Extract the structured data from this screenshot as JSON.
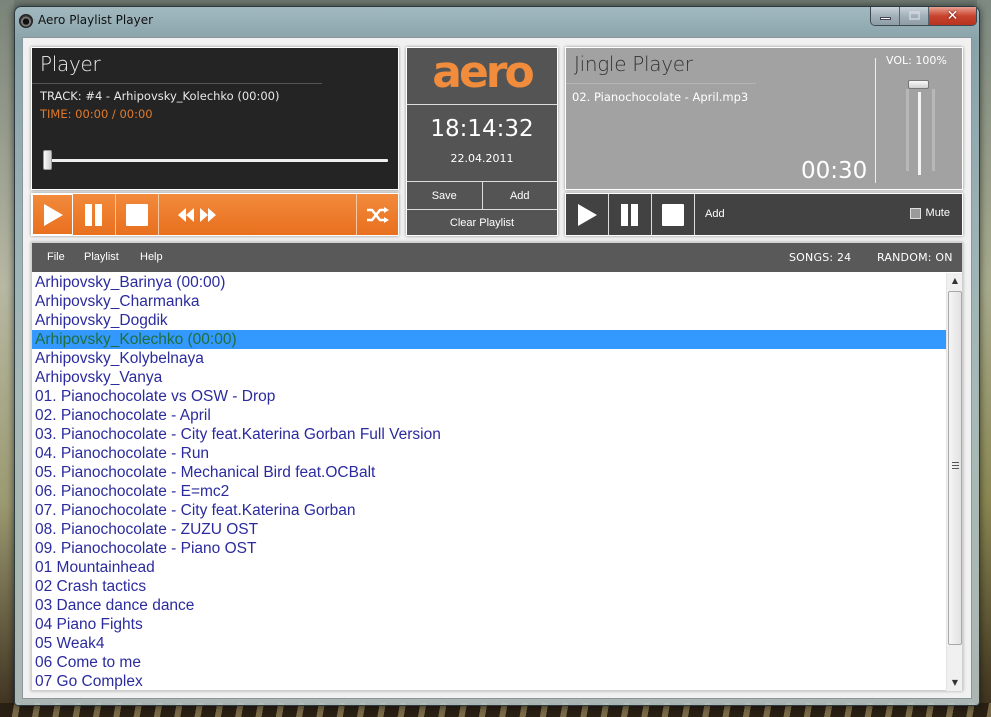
{
  "window": {
    "title": "Aero Playlist Player",
    "controls": {
      "minimize": "minimize",
      "maximize": "maximize",
      "close": "close"
    }
  },
  "player": {
    "title": "Player",
    "track": "TRACK: #4 - Arhipovsky_Kolechko (00:00)",
    "time": "TIME: 00:00 / 00:00",
    "seek_position_fraction": 0.0,
    "controls": [
      "play",
      "pause",
      "stop",
      "previous",
      "next",
      "shuffle"
    ]
  },
  "center": {
    "logo": "aero",
    "clock": "18:14:32",
    "date": "22.04.2011",
    "save_label": "Save",
    "add_label": "Add",
    "clear_label": "Clear Playlist"
  },
  "jingle": {
    "title": "Jingle Player",
    "file": "02. Pianochocolate - April.mp3",
    "remaining": "00:30",
    "volume_label": "VOL: 100%",
    "volume_fraction": 1.0,
    "add_label": "Add",
    "mute_label": "Mute",
    "mute_checked": false
  },
  "playlist": {
    "menu": [
      "File",
      "Playlist",
      "Help"
    ],
    "songs_count": "SONGS: 24",
    "random": "RANDOM: ON",
    "selected_index": 3,
    "songs": [
      "Arhipovsky_Barinya (00:00)",
      "Arhipovsky_Charmanka",
      "Arhipovsky_Dogdik",
      "Arhipovsky_Kolechko (00:00)",
      "Arhipovsky_Kolybelnaya",
      "Arhipovsky_Vanya",
      "01. Pianochocolate vs OSW - Drop",
      "02. Pianochocolate - April",
      "03. Pianochocolate - City feat.Katerina Gorban Full Version",
      "04. Pianochocolate - Run",
      "05. Pianochocolate - Mechanical Bird feat.OCBalt",
      "06. Pianochocolate - E=mc2",
      "07. Pianochocolate - City feat.Katerina Gorban",
      "08. Pianochocolate - ZUZU OST",
      "09. Pianochocolate - Piano OST",
      "01 Mountainhead",
      "02 Crash tactics",
      "03 Dance dance dance",
      "04 Piano Fights",
      "05 Weak4",
      "06 Come to me",
      "07 Go Complex"
    ]
  },
  "colors": {
    "accent_orange": "#f08c3c",
    "selection_blue": "#3399ff",
    "song_text": "#2b2b9e"
  }
}
